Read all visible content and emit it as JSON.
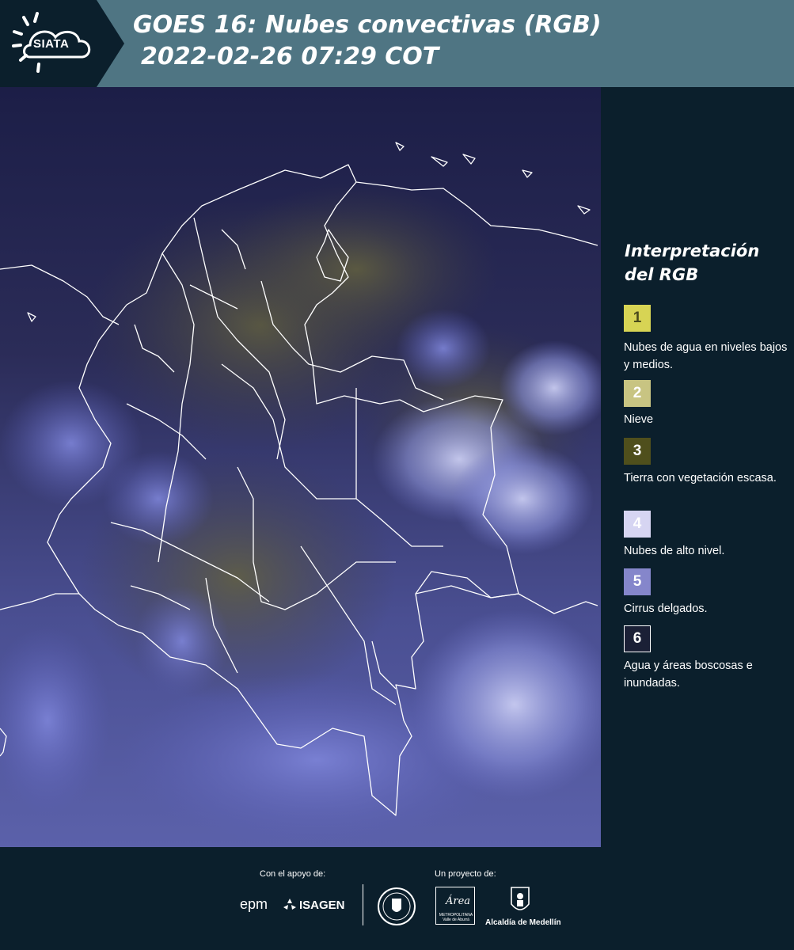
{
  "header": {
    "logo_text": "SIATA",
    "title_line1": "GOES 16: Nubes convectivas (RGB)",
    "title_line2": "2022-02-26 07:29 COT"
  },
  "map": {
    "description_icon": "satellite-rgb-image",
    "ocean_color": "#23254f",
    "cloud_color": "#7c86d6",
    "land_tint": "#57553a",
    "border_color": "#ffffff"
  },
  "legend": {
    "title": "Interpretación del RGB",
    "items": [
      {
        "number": "1",
        "label": "Nubes de agua en niveles bajos y medios.",
        "color": "#d7d454",
        "text_color": "#4a4a1c"
      },
      {
        "number": "2",
        "label": "Nieve",
        "color": "#c8c482",
        "text_color": "#ffffff"
      },
      {
        "number": "3",
        "label": "Tierra con vegetación escasa.",
        "color": "#4f4f1c",
        "text_color": "#ffffff"
      },
      {
        "number": "4",
        "label": "Nubes de alto nivel.",
        "color": "#d6d5f2",
        "text_color": "#ffffff"
      },
      {
        "number": "5",
        "label": "Cirrus delgados.",
        "color": "#8586cb",
        "text_color": "#ffffff"
      },
      {
        "number": "6",
        "label": "Agua y áreas boscosas e inundadas.",
        "color": "#1b2036",
        "text_color": "#ffffff"
      }
    ]
  },
  "footer": {
    "support_caption": "Con el apoyo de:",
    "project_caption": "Un proyecto de:",
    "sponsors": [
      "epm",
      "ISAGEN"
    ],
    "partner_area_text": "Área",
    "partner_area_subtext": "METROPOLITANA Valle de Aburrá",
    "partner_alcaldia": "Alcaldía de Medellín"
  }
}
